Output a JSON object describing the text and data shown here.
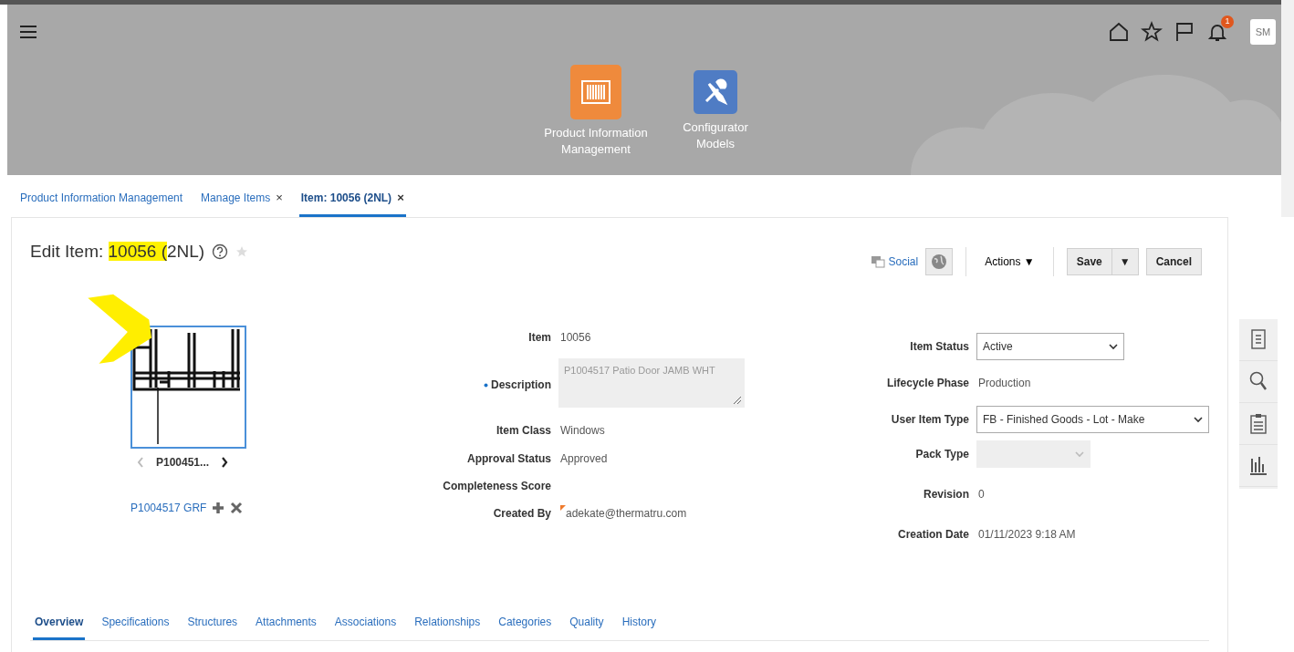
{
  "header": {
    "notification_count": "1",
    "avatar": "SM"
  },
  "apps": [
    {
      "label": "Product Information Management",
      "kind": "barcode",
      "color": "#ef8a3c"
    },
    {
      "label": "Configurator Models",
      "kind": "tools",
      "color": "#4f7cc4"
    }
  ],
  "breadcrumb_tabs": [
    {
      "label": "Product Information Management",
      "selected": false
    },
    {
      "label": "Manage Items",
      "selected": false,
      "close": "×"
    },
    {
      "label": "Item: 10056 (2NL)",
      "selected": true,
      "close": "×"
    }
  ],
  "title": [
    {
      "text": "Edit Item: ",
      "highlighted": false
    },
    {
      "text": "10056 (",
      "highlighted": true
    },
    {
      "text": "2NL)",
      "highlighted": false
    }
  ],
  "toolbar": {
    "social": "Social",
    "actions": "Actions ▼",
    "save": "Save",
    "save_menu": "▼",
    "cancel": "Cancel"
  },
  "image": {
    "caption": "P100451...",
    "previous_disabled": true,
    "next_disabled": false,
    "attachment": "P1004517 GRF"
  },
  "fields_middle": [
    {
      "label": "Item",
      "kind": "text",
      "value": "10056",
      "required": false
    },
    {
      "label": "Description",
      "kind": "textarea",
      "value": "P1004517 Patio Door JAMB WHT",
      "required": true
    },
    {
      "label": "Item Class",
      "kind": "text",
      "value": "Windows",
      "required": false
    },
    {
      "label": "Approval Status",
      "kind": "text",
      "value": "Approved",
      "required": false
    },
    {
      "label": "Completeness Score",
      "kind": "text",
      "required": false
    },
    {
      "label": "Created By",
      "kind": "user",
      "value": "adekate@thermatru.com",
      "required": false
    }
  ],
  "fields_right": [
    {
      "label": "Item Status",
      "kind": "select",
      "value": "Active",
      "disabled": false
    },
    {
      "label": "Lifecycle Phase",
      "kind": "text",
      "value": "Production"
    },
    {
      "label": "User Item Type",
      "kind": "select",
      "value": "FB - Finished Goods - Lot - Make",
      "disabled": false
    },
    {
      "label": "Pack Type",
      "kind": "select",
      "disabled": true
    },
    {
      "label": "Revision",
      "kind": "text",
      "value": "0"
    },
    {
      "label": "Creation Date",
      "kind": "text",
      "value": "01/11/2023 9:18 AM"
    }
  ],
  "detail_tabs": [
    {
      "label": "Overview",
      "selected": true
    },
    {
      "label": "Specifications",
      "selected": false
    },
    {
      "label": "Structures",
      "selected": false
    },
    {
      "label": "Attachments",
      "selected": false
    },
    {
      "label": "Associations",
      "selected": false
    },
    {
      "label": "Relationships",
      "selected": false
    },
    {
      "label": "Categories",
      "selected": false
    },
    {
      "label": "Quality",
      "selected": false
    },
    {
      "label": "History",
      "selected": false
    }
  ]
}
